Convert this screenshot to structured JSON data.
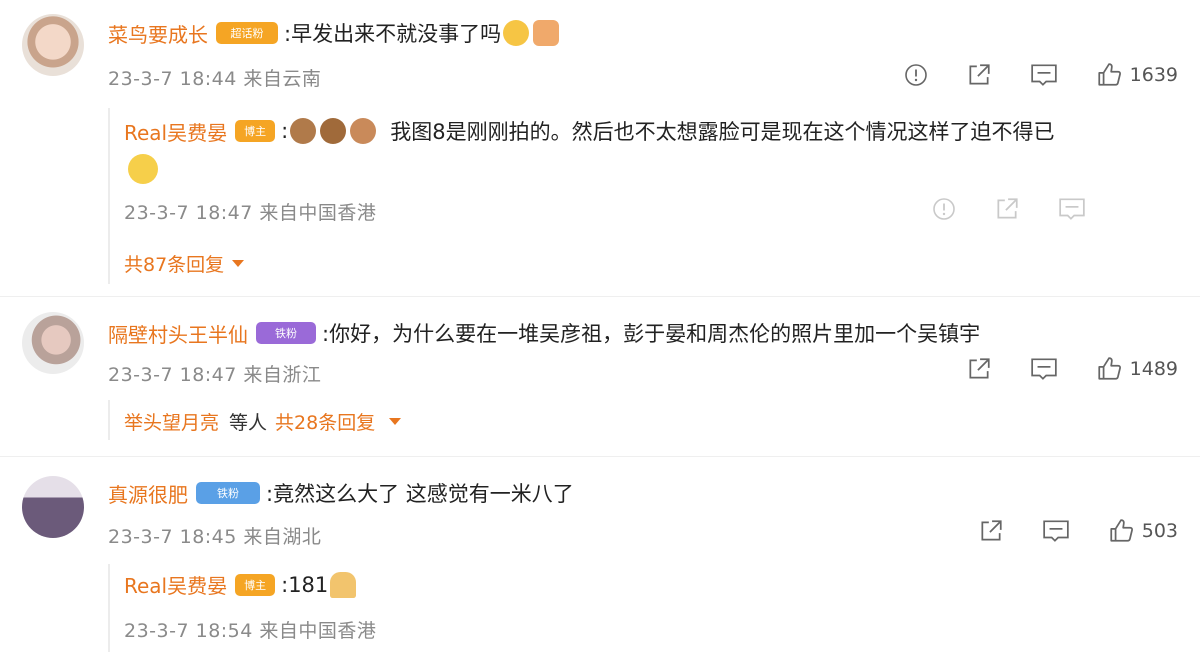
{
  "comments": [
    {
      "user": "菜鸟要成长",
      "badge": "超话粉",
      "text": ":早发出来不就没事了吗",
      "meta": "23-3-7 18:44 来自云南",
      "likes": "1639",
      "reply": {
        "user": "Real吴费晏",
        "badge": "博主",
        "text_line1": "我图8是刚刚拍的。然后也不太想露脸可是现在这个情况这样了迫不得已",
        "meta": "23-3-7 18:47 来自中国香港",
        "more": "共87条回复"
      }
    },
    {
      "user": "隔壁村头王半仙",
      "badge": "铁粉",
      "text": ":你好，为什么要在一堆吴彦祖，彭于晏和周杰伦的照片里加一个吴镇宇",
      "meta": "23-3-7 18:47 来自浙江",
      "likes": "1489",
      "reply_summary": {
        "user": "举头望月亮",
        "mid": "等人",
        "more": "共28条回复"
      }
    },
    {
      "user": "真源很肥",
      "badge": "铁粉",
      "text": ":竟然这么大了 这感觉有一米八了",
      "meta": "23-3-7 18:45 来自湖北",
      "likes": "503",
      "reply": {
        "user": "Real吴费晏",
        "badge": "博主",
        "text": ":181",
        "meta": "23-3-7 18:54 来自中国香港"
      }
    }
  ],
  "colors": {
    "name": "#e8761f",
    "meta": "#8a8a8a",
    "badge_orange": "#f5a524",
    "badge_purple": "#9a6ad8",
    "badge_blue": "#5aa0e6"
  }
}
